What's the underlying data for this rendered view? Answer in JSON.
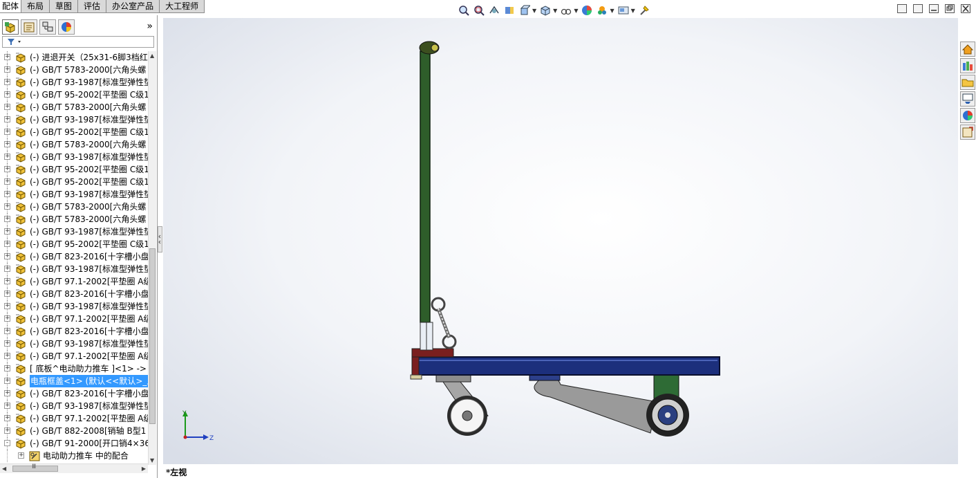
{
  "tabs": [
    "配体",
    "布局",
    "草图",
    "评估",
    "办公室产品",
    "大工程师"
  ],
  "tree": {
    "rows": [
      {
        "label": "(-) 进退开关（25x31-6脚3档红",
        "expand": "+"
      },
      {
        "label": "(-) GB/T 5783-2000[六角头螺",
        "expand": "+"
      },
      {
        "label": "(-) GB/T 93-1987[标准型弹性垫",
        "expand": "+"
      },
      {
        "label": "(-) GB/T 95-2002[平垫圈 C级1",
        "expand": "+"
      },
      {
        "label": "(-) GB/T 5783-2000[六角头螺",
        "expand": "+"
      },
      {
        "label": "(-) GB/T 93-1987[标准型弹性垫",
        "expand": "+"
      },
      {
        "label": "(-) GB/T 95-2002[平垫圈 C级1",
        "expand": "+"
      },
      {
        "label": "(-) GB/T 5783-2000[六角头螺",
        "expand": "+"
      },
      {
        "label": "(-) GB/T 93-1987[标准型弹性垫",
        "expand": "+"
      },
      {
        "label": "(-) GB/T 95-2002[平垫圈 C级1",
        "expand": "+"
      },
      {
        "label": "(-) GB/T 95-2002[平垫圈 C级1",
        "expand": "+"
      },
      {
        "label": "(-) GB/T 93-1987[标准型弹性垫",
        "expand": "+"
      },
      {
        "label": "(-) GB/T 5783-2000[六角头螺",
        "expand": "+"
      },
      {
        "label": "(-) GB/T 5783-2000[六角头螺",
        "expand": "+"
      },
      {
        "label": "(-) GB/T 93-1987[标准型弹性垫",
        "expand": "+"
      },
      {
        "label": "(-) GB/T 95-2002[平垫圈 C级1",
        "expand": "+"
      },
      {
        "label": "(-) GB/T 823-2016[十字槽小盘",
        "expand": "+"
      },
      {
        "label": "(-) GB/T 93-1987[标准型弹性垫",
        "expand": "+"
      },
      {
        "label": "(-) GB/T 97.1-2002[平垫圈 A级",
        "expand": "+"
      },
      {
        "label": "(-) GB/T 823-2016[十字槽小盘",
        "expand": "+"
      },
      {
        "label": "(-) GB/T 93-1987[标准型弹性垫",
        "expand": "+"
      },
      {
        "label": "(-) GB/T 97.1-2002[平垫圈 A级",
        "expand": "+"
      },
      {
        "label": "(-) GB/T 823-2016[十字槽小盘",
        "expand": "+"
      },
      {
        "label": "(-) GB/T 93-1987[标准型弹性垫",
        "expand": "+"
      },
      {
        "label": "(-) GB/T 97.1-2002[平垫圈 A级",
        "expand": "+"
      },
      {
        "label": "[ 底板^电动助力推车 ]<1> ->",
        "expand": "+"
      },
      {
        "label": "电瓶框盖<1> (默认<<默认>_显",
        "expand": "+",
        "selected": true
      },
      {
        "label": "(-) GB/T 823-2016[十字槽小盘",
        "expand": "+"
      },
      {
        "label": "(-) GB/T 93-1987[标准型弹性垫",
        "expand": "+"
      },
      {
        "label": "(-) GB/T 97.1-2002[平垫圈 A级",
        "expand": "+"
      },
      {
        "label": "(-) GB/T 882-2008[销轴 B型1",
        "expand": "+"
      },
      {
        "label": "(-) GB/T 91-2000[开口销4×36",
        "expand": "-"
      },
      {
        "label": "电动助力推车 中的配合",
        "expand": "+",
        "child": true
      }
    ]
  },
  "hscroll_grip": "Ⅲ",
  "view_label": "*左视",
  "triad": {
    "y": "Y",
    "z": "Z"
  },
  "colors": {
    "frame_blue": "#1c2f7c",
    "handle_green": "#2e5d2a",
    "caster_gray": "#9a9a9a",
    "tire_dark": "#2b2b2b",
    "selection": "#3399ff"
  }
}
